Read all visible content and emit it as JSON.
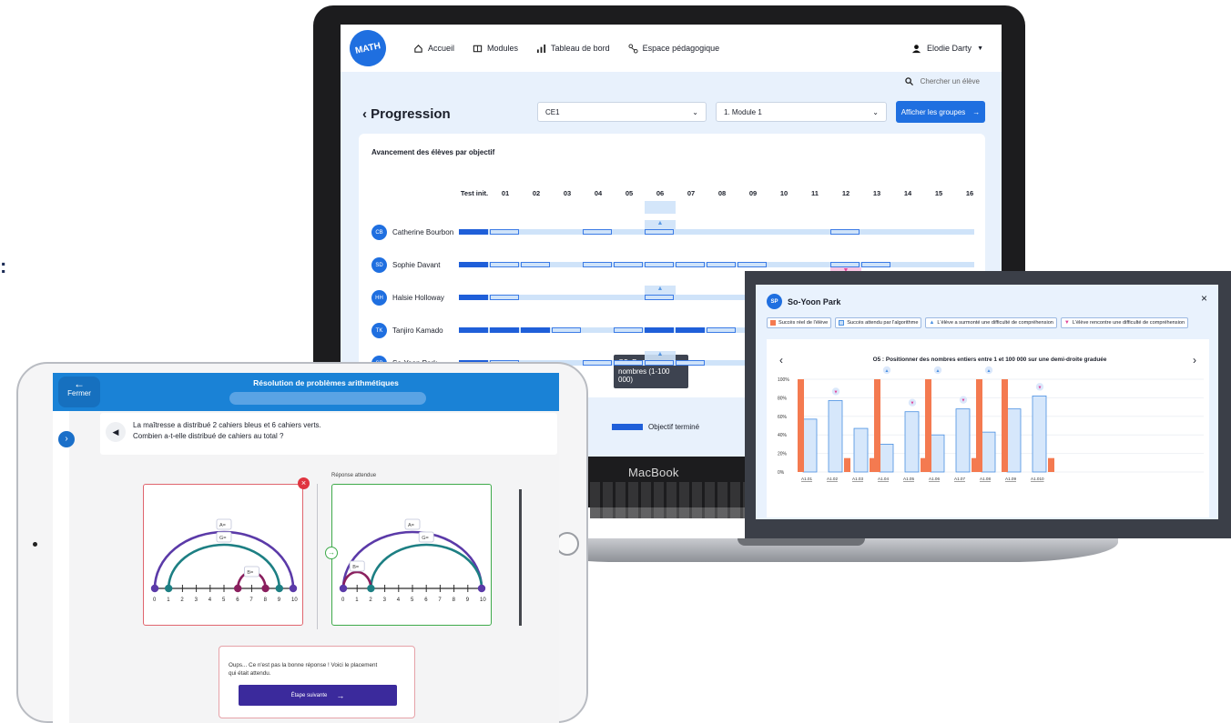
{
  "edge_glyph": ":",
  "laptop": {
    "brand_text": "MATH",
    "nav": [
      "Accueil",
      "Modules",
      "Tableau de bord",
      "Espace pédagogique"
    ],
    "user_name": "Elodie Darty",
    "search_placeholder": "Chercher un élève",
    "page_title": "Progression",
    "grade_select": "CE1",
    "module_select": "1. Module 1",
    "show_groups_button": "Afficher les groupes",
    "card_title": "Avancement des élèves par objectif",
    "columns": [
      "Test init.",
      "01",
      "02",
      "03",
      "04",
      "05",
      "06",
      "07",
      "08",
      "09",
      "10",
      "11",
      "12",
      "13",
      "14",
      "15",
      "16"
    ],
    "students": [
      {
        "initials": "CB",
        "name": "Catherine Bourbon"
      },
      {
        "initials": "SD",
        "name": "Sophie Davant"
      },
      {
        "initials": "HH",
        "name": "Halsie Holloway"
      },
      {
        "initials": "TK",
        "name": "Tanjiro Kamado"
      },
      {
        "initials": "SP",
        "name": "So-Yoon Park"
      }
    ],
    "tooltip_line1": "O5. Positionner des",
    "tooltip_line2": "nombres (1-100 000)",
    "legend_done": "Objectif terminé",
    "device_label": "MacBook"
  },
  "popup": {
    "student_initials": "SP",
    "student_name": "So-Yoon Park",
    "legend": [
      {
        "label": "Succès réel de l'élève",
        "color": "#f47a50"
      },
      {
        "label": "Succès attendu par l'algorithme",
        "color": "#c9dff8"
      },
      {
        "label": "L'élève a surmonté une difficulté de compréhension",
        "color": "#4a90e2"
      },
      {
        "label": "L'élève rencontre une difficulté de compréhension",
        "color": "#e0469a"
      }
    ],
    "chart_title": "O5 : Positionner des nombres entiers entre 1 et 100 000 sur une demi-droite graduée"
  },
  "chart_data": {
    "type": "bar",
    "categories": [
      "A1.01",
      "A1.02",
      "A1.03",
      "A1.04",
      "A1.05",
      "A1.06",
      "A1.07",
      "A1.08",
      "A1.09",
      "A1.010"
    ],
    "ylim": [
      0,
      100
    ],
    "yticks": [
      "100%",
      "80%",
      "60%",
      "40%",
      "20%",
      "0%"
    ],
    "series": [
      {
        "name": "Succès réel de l'élève",
        "values": [
          100,
          15,
          15,
          100,
          15,
          100,
          15,
          100,
          100,
          15
        ],
        "color": "#f47a50"
      },
      {
        "name": "Succès attendu par l'algorithme",
        "values": [
          57,
          77,
          47,
          30,
          65,
          40,
          68,
          43,
          68,
          82
        ],
        "color": "#d6e7fb"
      }
    ],
    "markers": [
      "",
      "down",
      "",
      "up",
      "down",
      "up",
      "down",
      "up",
      "",
      "down"
    ]
  },
  "tablet": {
    "back_label": "Fermer",
    "header_title": "Résolution de problèmes arithmétiques",
    "problem_line1": "La maîtresse a distribué 2 cahiers bleus et 6 cahiers verts.",
    "problem_line2": "Combien a-t-elle distribué de cahiers au total ?",
    "expected_label": "Réponse attendue",
    "arc_labels": [
      "A=",
      "G=",
      "B="
    ],
    "numberline": [
      "0",
      "1",
      "2",
      "3",
      "4",
      "5",
      "6",
      "7",
      "8",
      "9",
      "10"
    ],
    "feedback_line1": "Oups... Ce n'est pas la bonne réponse ! Voici le placement",
    "feedback_line2": "qui était attendu.",
    "next_button": "Étape suivante"
  }
}
